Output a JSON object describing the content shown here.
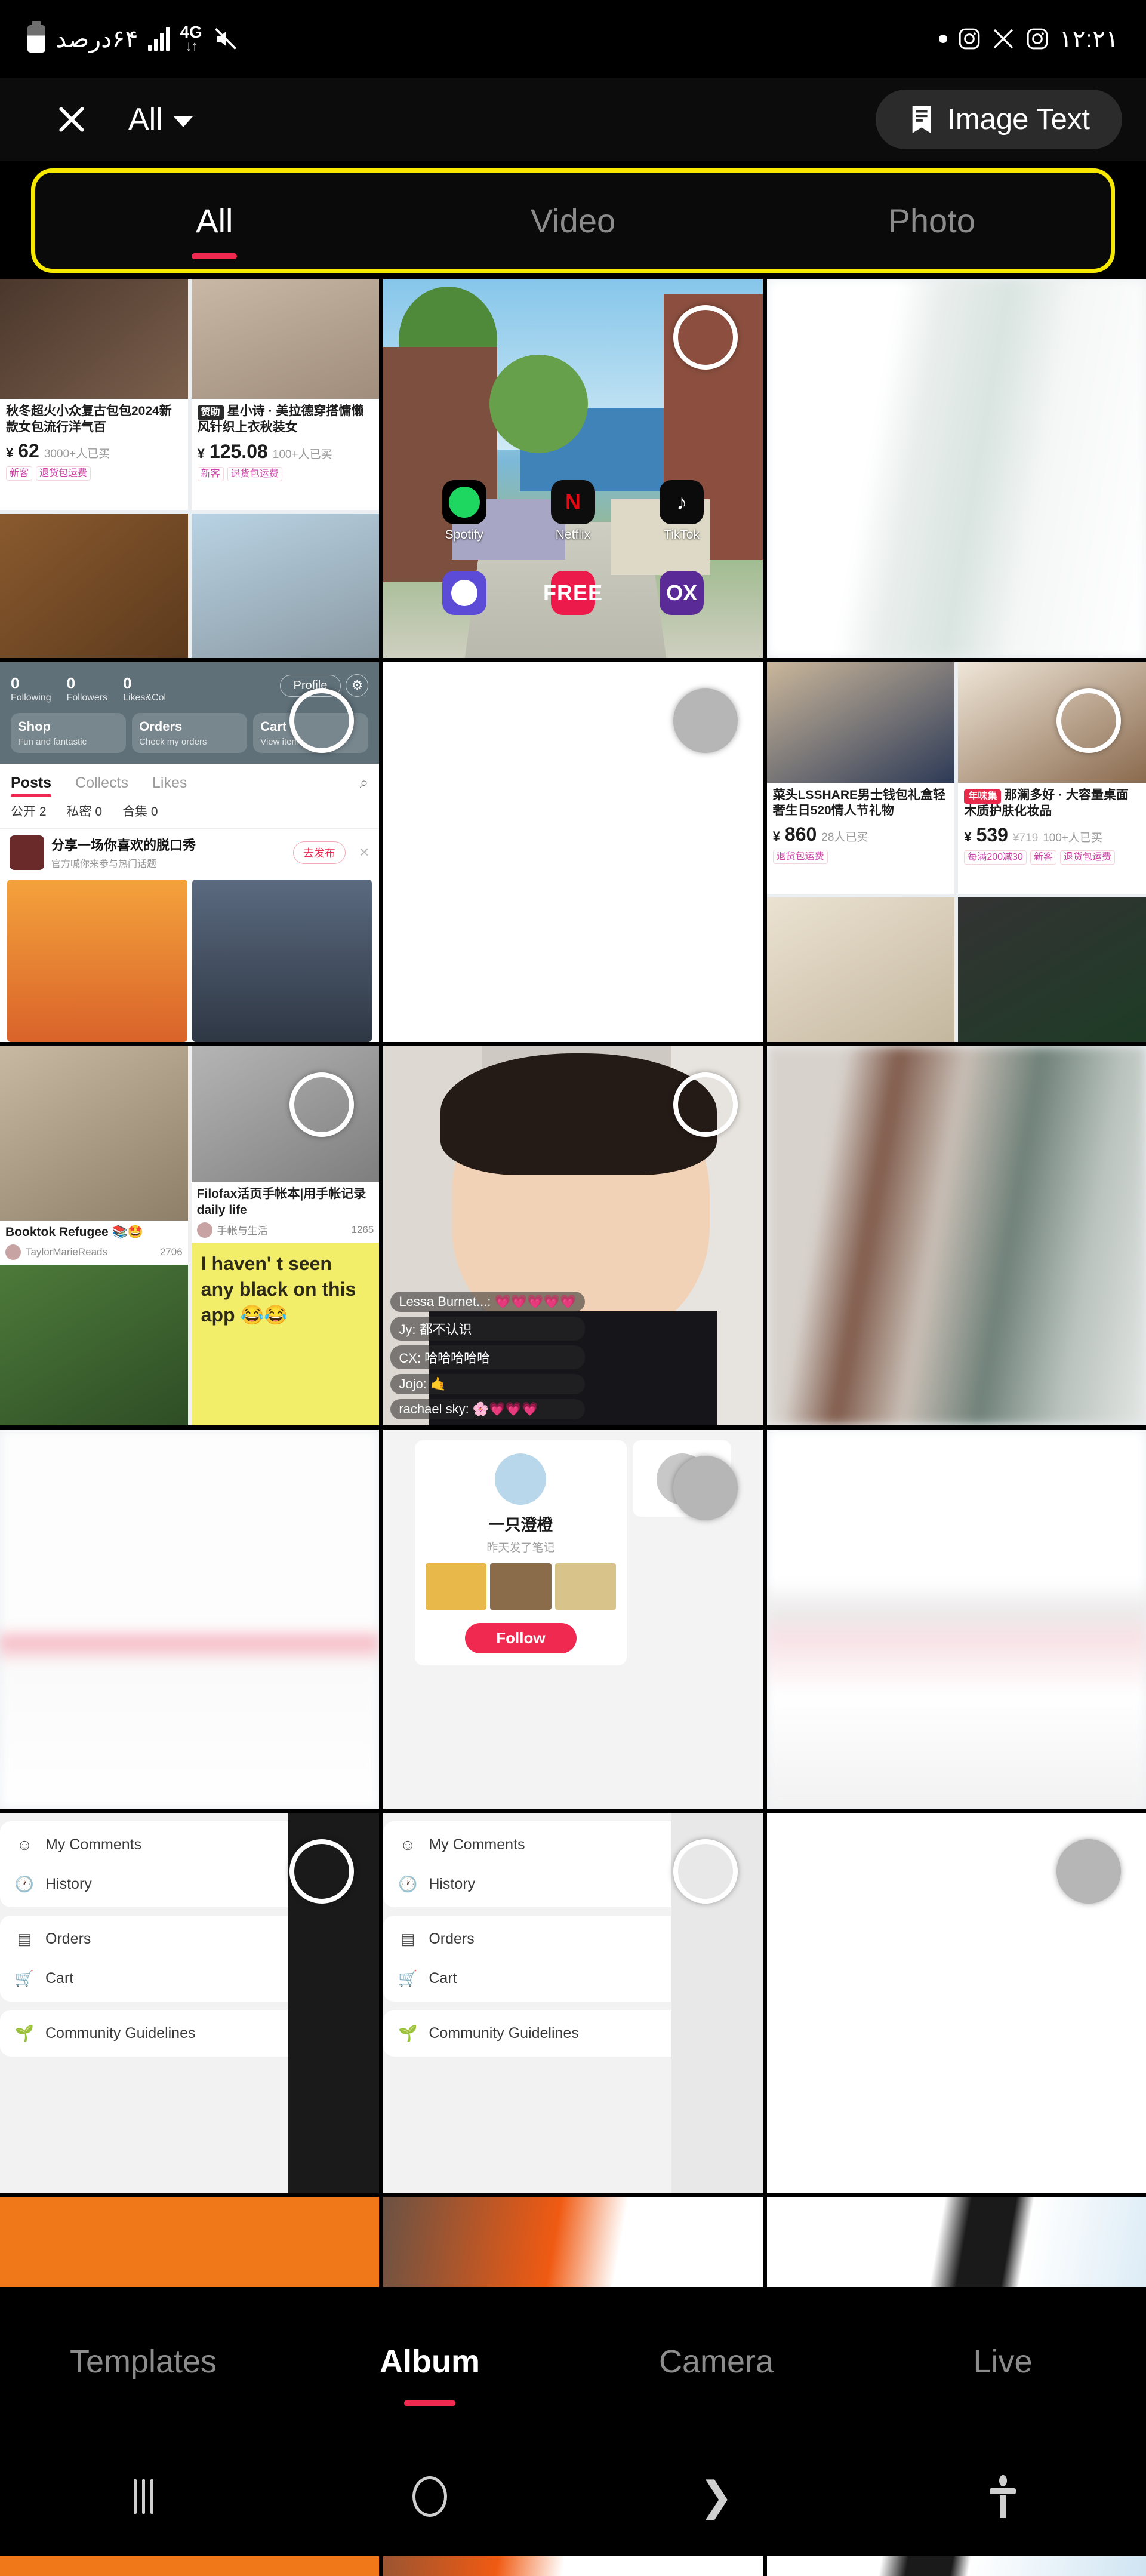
{
  "status_bar": {
    "battery_percent_label": "۶۴درصد",
    "network_type": "4G",
    "time": "۱۲:۲۱",
    "icons": [
      "battery-icon",
      "signal-bars-icon",
      "data-transfer-icon",
      "mute-icon",
      "dot-indicator",
      "instagram-icon",
      "x-twitter-icon",
      "instagram-icon",
      "clock-time"
    ]
  },
  "header": {
    "close_label": "✕",
    "album_label": "All",
    "image_text_label": "Image Text"
  },
  "filter_tabs": {
    "highlight_color": "#f7e800",
    "active_index": 0,
    "active_underline_color": "#ef2950",
    "items": [
      {
        "label": "All"
      },
      {
        "label": "Video"
      },
      {
        "label": "Photo"
      }
    ]
  },
  "media_grid": {
    "columns": 3,
    "cells": [
      {
        "id": "cell-1",
        "kind": "shopping-screenshot",
        "selected": false,
        "selection_marker": "none",
        "products": [
          {
            "title": "秋冬超火小众复古包包2024新款女包流行洋气百",
            "currency": "¥",
            "price": "62",
            "sold": "3000+人已买",
            "tags": [
              "新客",
              "退货包运费"
            ],
            "photo_color": "#5a4236"
          },
          {
            "title": "星小诗 · 美拉德穿搭慵懒风针织上衣秋装女",
            "badge": "赞助",
            "currency": "¥",
            "price": "125.08",
            "sold": "100+人已买",
            "tags": [
              "新客",
              "退货包运费"
            ],
            "photo_color": "#bfae9e"
          },
          {
            "title": "",
            "photo_color": "#7b5232"
          },
          {
            "title": "",
            "photo_color": "#a9c6da"
          }
        ]
      },
      {
        "id": "cell-2",
        "kind": "phone-homescreen",
        "selected": false,
        "selection_marker": "ring",
        "apps_row1": [
          {
            "name": "Spotify",
            "icon": "spotify-icon"
          },
          {
            "name": "Netflix",
            "icon": "netflix-icon",
            "glyph": "N"
          },
          {
            "name": "TikTok",
            "icon": "tiktok-icon",
            "glyph": "♪"
          }
        ],
        "apps_row2": [
          {
            "name": "",
            "icon": "purple-app-icon"
          },
          {
            "name": "",
            "icon": "free-app-icon",
            "glyph": "FREE"
          },
          {
            "name": "",
            "icon": "ox-app-icon",
            "glyph": "OX"
          }
        ]
      },
      {
        "id": "cell-3",
        "kind": "blurred-screenshot",
        "selected": false,
        "selection_marker": "none",
        "tint": "#f2f4f3"
      },
      {
        "id": "cell-4",
        "kind": "profile-screenshot",
        "selected": false,
        "selection_marker": "ring",
        "stats": [
          {
            "value": "0",
            "label": "Following"
          },
          {
            "value": "0",
            "label": "Followers"
          },
          {
            "value": "0",
            "label": "Likes&Col"
          }
        ],
        "profile_button": "Profile",
        "gear_icon": "gear-icon",
        "cards": [
          {
            "title": "Shop",
            "subtitle": "Fun and fantastic"
          },
          {
            "title": "Orders",
            "subtitle": "Check my orders"
          },
          {
            "title": "Cart",
            "subtitle": "View items"
          }
        ],
        "tabs": [
          "Posts",
          "Collects",
          "Likes"
        ],
        "active_tab": "Posts",
        "search_icon": "search-icon",
        "sub_counts": [
          "公开 2",
          "私密 0",
          "合集 0"
        ],
        "banner": {
          "title": "分享一场你喜欢的脱口秀",
          "subtitle": "官方喊你来参与热门话题",
          "cta": "去发布",
          "close": "✕"
        }
      },
      {
        "id": "cell-5",
        "kind": "blank-white",
        "selected": true,
        "selection_marker": "filled",
        "tint": "#ffffff"
      },
      {
        "id": "cell-6",
        "kind": "shopping-screenshot",
        "selected": false,
        "selection_marker": "ring",
        "products": [
          {
            "title": "菜头LSSHARE男士钱包礼盒轻奢生日520情人节礼物",
            "currency": "¥",
            "price": "860",
            "sold": "28人已买",
            "tags": [
              "退货包运费"
            ],
            "photo_color": "#2b3550"
          },
          {
            "title": "那澜多好 · 大容量桌面木质护肤化妆品",
            "badge_red": "年味集",
            "currency": "¥",
            "price": "539",
            "old_price": "¥719",
            "sold": "100+人已买",
            "tags": [
              "每满200减30",
              "新客",
              "退货包运费"
            ],
            "photo_color": "#8a6a4e"
          },
          {
            "title": "",
            "photo_color": "#ded3c6"
          },
          {
            "title": "",
            "photo_color": "#2a2a2a"
          }
        ]
      },
      {
        "id": "cell-7",
        "kind": "notes-feed",
        "selected": false,
        "selection_marker": "ring",
        "notes": [
          {
            "caption": "Booktok Refugee 📚🤩",
            "author": "TaylorMarieReads",
            "likes": "2706",
            "photo_color": "#c8b49a"
          },
          {
            "caption": "Filofax活页手帐本|用手帐记录daily life",
            "author": "手帐与生活",
            "likes": "1265",
            "photo_color": "#9d9d9d"
          }
        ],
        "sticky_note_text": "I haven' t seen any black on this app 😂😂",
        "video_tile_color": "#3f5a35"
      },
      {
        "id": "cell-8",
        "kind": "livestream-screenshot",
        "selected": false,
        "selection_marker": "ring",
        "comments": [
          "Lessa Burnet...: 💗💗💗💗💗",
          "Jy: 都不认识",
          "CX: 哈哈哈哈哈",
          "Jojo: 🤙",
          "rachael sky: 🌸💗💗💗"
        ]
      },
      {
        "id": "cell-9",
        "kind": "blurred-screenshot",
        "selected": false,
        "selection_marker": "none",
        "tint": "#9aa4a0"
      },
      {
        "id": "cell-10",
        "kind": "blurred-screenshot",
        "selected": false,
        "selection_marker": "none",
        "tint": "#f5f2f2"
      },
      {
        "id": "cell-11",
        "kind": "user-recommend-card",
        "selected": true,
        "selection_marker": "filled",
        "card": {
          "name": "一只澄橙",
          "subtitle": "昨天发了笔记",
          "follow_label": "Follow",
          "thumbs": [
            "#e8b94a",
            "#8a6b4a",
            "#d8c48a"
          ]
        }
      },
      {
        "id": "cell-12",
        "kind": "blurred-screenshot",
        "selected": false,
        "selection_marker": "none",
        "tint": "#f4f1ef"
      },
      {
        "id": "cell-13",
        "kind": "drawer-menu",
        "selected": false,
        "selection_marker": "ring",
        "groups": [
          [
            {
              "label": "My Comments",
              "icon": "comment-icon"
            },
            {
              "label": "History",
              "icon": "history-clock-icon"
            }
          ],
          [
            {
              "label": "Orders",
              "icon": "clipboard-icon"
            },
            {
              "label": "Cart",
              "icon": "cart-icon"
            }
          ],
          [
            {
              "label": "Community Guidelines",
              "icon": "sprout-icon"
            }
          ]
        ]
      },
      {
        "id": "cell-14",
        "kind": "drawer-menu",
        "selected": false,
        "selection_marker": "ring",
        "groups": [
          [
            {
              "label": "My Comments",
              "icon": "comment-icon"
            },
            {
              "label": "History",
              "icon": "history-clock-icon"
            }
          ],
          [
            {
              "label": "Orders",
              "icon": "clipboard-icon"
            },
            {
              "label": "Cart",
              "icon": "cart-icon"
            }
          ],
          [
            {
              "label": "Community Guidelines",
              "icon": "sprout-icon"
            }
          ]
        ]
      },
      {
        "id": "cell-15",
        "kind": "blank-white",
        "selected": true,
        "selection_marker": "filled",
        "tint": "#ffffff"
      },
      {
        "id": "cell-16",
        "kind": "solid-tile",
        "selected": false,
        "selection_marker": "none",
        "tint": "#f07818"
      },
      {
        "id": "cell-17",
        "kind": "solid-tile",
        "selected": false,
        "selection_marker": "none",
        "tint": "#6a5244"
      },
      {
        "id": "cell-18",
        "kind": "solid-tile",
        "selected": false,
        "selection_marker": "none",
        "tint": "#fafafa"
      }
    ]
  },
  "bottom_nav": {
    "active_index": 1,
    "active_underline_color": "#ef2950",
    "items": [
      {
        "label": "Templates"
      },
      {
        "label": "Album"
      },
      {
        "label": "Camera"
      },
      {
        "label": "Live"
      }
    ]
  },
  "android_nav": {
    "items": [
      {
        "icon": "recents-icon"
      },
      {
        "icon": "home-icon"
      },
      {
        "icon": "back-icon"
      },
      {
        "icon": "accessibility-icon"
      }
    ]
  }
}
